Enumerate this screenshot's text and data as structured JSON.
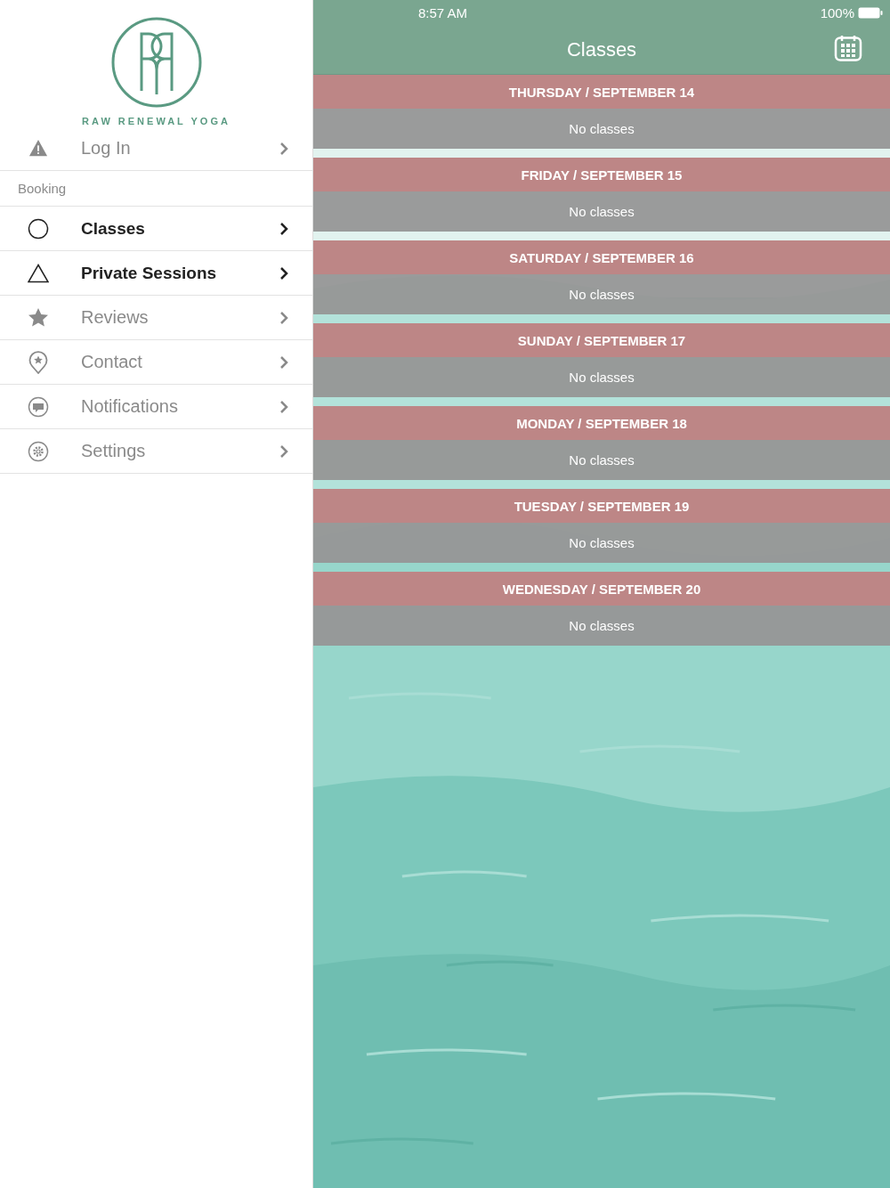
{
  "sidebar": {
    "brand": "RAW RENEWAL YOGA",
    "login": {
      "label": "Log In",
      "kind": "warning",
      "disabled": true
    },
    "section": "Booking",
    "items": [
      {
        "label": "Classes",
        "kind": "circle",
        "disabled": false
      },
      {
        "label": "Private Sessions",
        "kind": "triangle",
        "disabled": false
      },
      {
        "label": "Reviews",
        "kind": "star",
        "disabled": true
      },
      {
        "label": "Contact",
        "kind": "pin",
        "disabled": true
      },
      {
        "label": "Notifications",
        "kind": "chat",
        "disabled": true
      },
      {
        "label": "Settings",
        "kind": "gear",
        "disabled": true
      }
    ]
  },
  "status_bar": {
    "time": "8:57 AM",
    "battery": "100%"
  },
  "header": {
    "title": "Classes"
  },
  "days": [
    {
      "date": "THURSDAY / SEPTEMBER 14",
      "note": "No classes"
    },
    {
      "date": "FRIDAY / SEPTEMBER 15",
      "note": "No classes"
    },
    {
      "date": "SATURDAY / SEPTEMBER 16",
      "note": "No classes"
    },
    {
      "date": "SUNDAY / SEPTEMBER 17",
      "note": "No classes"
    },
    {
      "date": "MONDAY / SEPTEMBER 18",
      "note": "No classes"
    },
    {
      "date": "TUESDAY / SEPTEMBER 19",
      "note": "No classes"
    },
    {
      "date": "WEDNESDAY / SEPTEMBER 20",
      "note": "No classes"
    }
  ]
}
